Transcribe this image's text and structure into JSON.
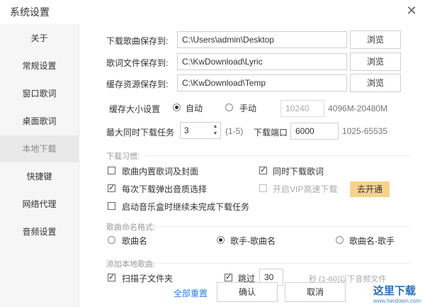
{
  "window": {
    "title": "系统设置"
  },
  "sidebar": {
    "items": [
      {
        "label": "关于"
      },
      {
        "label": "常规设置"
      },
      {
        "label": "窗口歌词"
      },
      {
        "label": "桌面歌词"
      },
      {
        "label": "本地下载"
      },
      {
        "label": "快捷键"
      },
      {
        "label": "网络代理"
      },
      {
        "label": "音频设置"
      }
    ],
    "active_index": 4
  },
  "paths": {
    "song": {
      "label": "下载歌曲保存到:",
      "value": "C:\\Users\\admin\\Desktop",
      "browse": "浏览"
    },
    "lyric": {
      "label": "歌词文件保存到:",
      "value": "C:\\KwDownload\\Lyric",
      "browse": "浏览"
    },
    "cache": {
      "label": "缓存资源保存到:",
      "value": "C:\\KwDownload\\Temp",
      "browse": "浏览"
    }
  },
  "cache_size": {
    "label": "缓存大小设置",
    "auto": "自动",
    "manual": "手动",
    "value": "10240",
    "range": "4096M-20480M",
    "selected": "auto"
  },
  "max_tasks": {
    "label": "最大同时下载任务",
    "value": "3",
    "range": "(1-5)"
  },
  "port": {
    "label": "下载端口",
    "value": "6000",
    "range": "1025-65535"
  },
  "habits": {
    "title": "下载习惯:",
    "embed_lyrics": {
      "label": "歌曲内置歌词及封面",
      "checked": false
    },
    "sync_lyrics": {
      "label": "同时下载歌词",
      "checked": true
    },
    "popup_quality": {
      "label": "每次下载弹出音质选择",
      "checked": true
    },
    "vip_speed": {
      "label": "开启VIP高速下载",
      "checked": false
    },
    "open_vip": "去开通",
    "resume": {
      "label": "启动音乐盒时继续未完成下载任务",
      "checked": false
    }
  },
  "naming": {
    "title": "歌曲命名格式:",
    "options": [
      "歌曲名",
      "歌手-歌曲名",
      "歌曲名-歌手"
    ],
    "selected": 1
  },
  "local_add": {
    "title": "添加本地歌曲:",
    "scan_sub": {
      "label": "扫描子文件夹",
      "checked": true
    },
    "skip": {
      "label": "跳过",
      "checked": true,
      "value": "30",
      "suffix": "秒 (1-60)以下音频文件"
    }
  },
  "footer": {
    "reset": "全部重置",
    "ok": "确认",
    "cancel": "取消"
  },
  "watermark": {
    "text": "这里下载",
    "sub": "www.herdown.com"
  }
}
